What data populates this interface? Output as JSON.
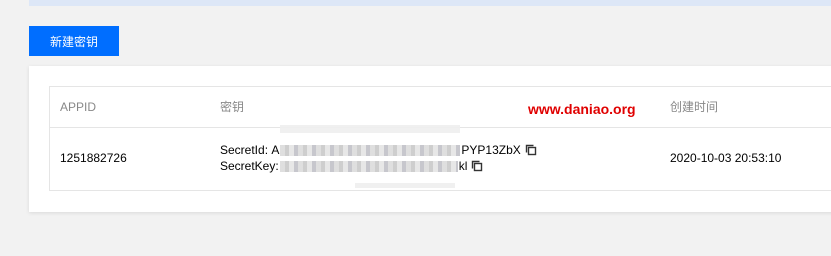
{
  "toolbar": {
    "create_key_label": "新建密钥"
  },
  "watermark": "www.daniao.org",
  "table": {
    "columns": [
      "APPID",
      "密钥",
      "创建时间"
    ],
    "rows": [
      {
        "appid": "1251882726",
        "secret_id_label": "SecretId:",
        "secret_id_start": "A",
        "secret_id_end": "PYP13ZbX",
        "secret_key_label": "SecretKey:",
        "secret_key_end": "kl",
        "created_at": "2020-10-03 20:53:10"
      }
    ]
  },
  "icons": {
    "copy": "copy-icon"
  },
  "colors": {
    "primary": "#006eff",
    "watermark": "#e00000"
  }
}
